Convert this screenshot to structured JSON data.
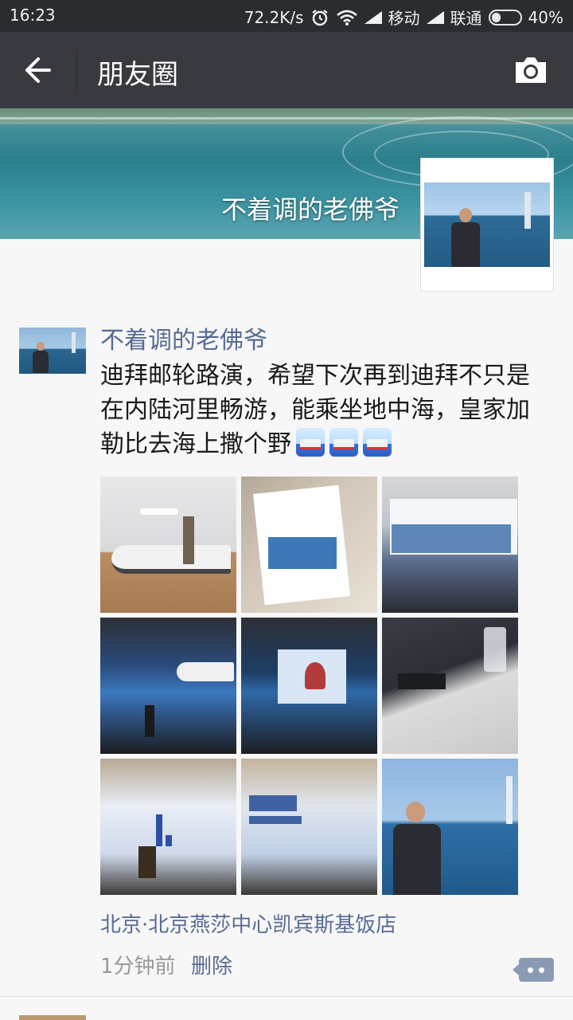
{
  "status_bar": {
    "time": "16:23",
    "net_speed": "72.2K/s",
    "carrier1": "移动",
    "carrier2": "联通",
    "battery": "40%",
    "battery_level": 0.4
  },
  "nav": {
    "title": "朋友圈",
    "back_icon": "arrow-left-icon",
    "camera_icon": "camera-icon"
  },
  "cover": {
    "display_name": "不着调的老佛爷"
  },
  "post": {
    "author": "不着调的老佛爷",
    "text": "迪拜邮轮路演，希望下次再到迪拜不只是在内陆河里畅游，能乘坐地中海，皇家加勒比去海上撒个野",
    "emoji": [
      "ship-emoji",
      "ship-emoji",
      "ship-emoji"
    ],
    "location": "北京·北京燕莎中心凯宾斯基饭店",
    "time_ago": "1分钟前",
    "delete_label": "删除",
    "comment_icon": "comment-dots-icon"
  },
  "colors": {
    "status_bg": "#2a2d2f",
    "nav_bg": "#393a3f",
    "link": "#576b95",
    "page_bg": "#f7f7f7"
  }
}
